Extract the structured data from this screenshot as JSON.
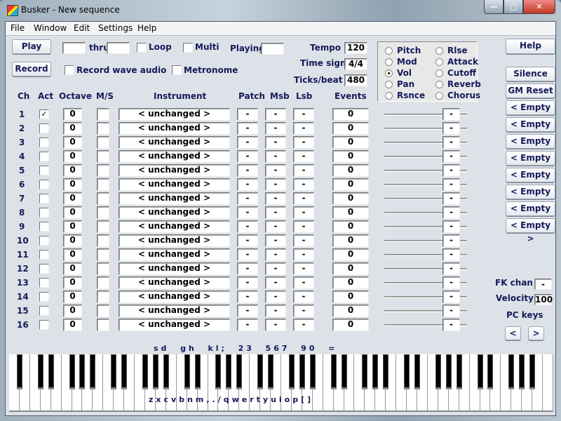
{
  "window": {
    "title": "Busker - New sequence",
    "min": "—",
    "max": "□",
    "close": "✕"
  },
  "menu": [
    "File",
    "Window",
    "Edit",
    "Settings",
    "Help"
  ],
  "transport": {
    "play": "Play",
    "record": "Record",
    "thru": "thru",
    "loop": "Loop",
    "multi": "Multi",
    "playing": "Playing",
    "record_wave": "Record wave audio",
    "metronome": "Metronome",
    "from_value": "",
    "thru_value": "",
    "playing_value": ""
  },
  "settings": {
    "tempo_label": "Tempo",
    "tempo": "120",
    "timesig_label": "Time sign",
    "timesig": "4/4",
    "ticks_label": "Ticks/beat",
    "ticks": "480"
  },
  "controllers": {
    "options": [
      "Pitch",
      "Mod",
      "Vol",
      "Pan",
      "Rsnce",
      "Rlse",
      "Attack",
      "Cutoff",
      "Reverb",
      "Chorus"
    ],
    "selected": "Vol"
  },
  "right_buttons": {
    "help": "Help",
    "silence": "Silence",
    "gm_reset": "GM Reset",
    "presets": [
      "< Empty >",
      "< Empty >",
      "< Empty >",
      "< Empty >",
      "< Empty >",
      "< Empty >",
      "< Empty >",
      "< Empty >"
    ]
  },
  "headers": {
    "ch": "Ch",
    "act": "Act",
    "octave": "Octave",
    "ms": "M/S",
    "instrument": "Instrument",
    "patch": "Patch",
    "msb": "Msb",
    "lsb": "Lsb",
    "events": "Events"
  },
  "channels": [
    {
      "ch": "1",
      "act": true,
      "octave": "0",
      "ms": "",
      "instrument": "< unchanged >",
      "patch": "-",
      "msb": "-",
      "lsb": "-",
      "events": "0",
      "ctrl": "-"
    },
    {
      "ch": "2",
      "act": false,
      "octave": "0",
      "ms": "",
      "instrument": "< unchanged >",
      "patch": "-",
      "msb": "-",
      "lsb": "-",
      "events": "0",
      "ctrl": "-"
    },
    {
      "ch": "3",
      "act": false,
      "octave": "0",
      "ms": "",
      "instrument": "< unchanged >",
      "patch": "-",
      "msb": "-",
      "lsb": "-",
      "events": "0",
      "ctrl": "-"
    },
    {
      "ch": "4",
      "act": false,
      "octave": "0",
      "ms": "",
      "instrument": "< unchanged >",
      "patch": "-",
      "msb": "-",
      "lsb": "-",
      "events": "0",
      "ctrl": "-"
    },
    {
      "ch": "5",
      "act": false,
      "octave": "0",
      "ms": "",
      "instrument": "< unchanged >",
      "patch": "-",
      "msb": "-",
      "lsb": "-",
      "events": "0",
      "ctrl": "-"
    },
    {
      "ch": "6",
      "act": false,
      "octave": "0",
      "ms": "",
      "instrument": "< unchanged >",
      "patch": "-",
      "msb": "-",
      "lsb": "-",
      "events": "0",
      "ctrl": "-"
    },
    {
      "ch": "7",
      "act": false,
      "octave": "0",
      "ms": "",
      "instrument": "< unchanged >",
      "patch": "-",
      "msb": "-",
      "lsb": "-",
      "events": "0",
      "ctrl": "-"
    },
    {
      "ch": "8",
      "act": false,
      "octave": "0",
      "ms": "",
      "instrument": "< unchanged >",
      "patch": "-",
      "msb": "-",
      "lsb": "-",
      "events": "0",
      "ctrl": "-"
    },
    {
      "ch": "9",
      "act": false,
      "octave": "0",
      "ms": "",
      "instrument": "< unchanged >",
      "patch": "-",
      "msb": "-",
      "lsb": "-",
      "events": "0",
      "ctrl": "-"
    },
    {
      "ch": "10",
      "act": false,
      "octave": "0",
      "ms": "",
      "instrument": "< unchanged >",
      "patch": "-",
      "msb": "-",
      "lsb": "-",
      "events": "0",
      "ctrl": "-"
    },
    {
      "ch": "11",
      "act": false,
      "octave": "0",
      "ms": "",
      "instrument": "< unchanged >",
      "patch": "-",
      "msb": "-",
      "lsb": "-",
      "events": "0",
      "ctrl": "-"
    },
    {
      "ch": "12",
      "act": false,
      "octave": "0",
      "ms": "",
      "instrument": "< unchanged >",
      "patch": "-",
      "msb": "-",
      "lsb": "-",
      "events": "0",
      "ctrl": "-"
    },
    {
      "ch": "13",
      "act": false,
      "octave": "0",
      "ms": "",
      "instrument": "< unchanged >",
      "patch": "-",
      "msb": "-",
      "lsb": "-",
      "events": "0",
      "ctrl": "-"
    },
    {
      "ch": "14",
      "act": false,
      "octave": "0",
      "ms": "",
      "instrument": "< unchanged >",
      "patch": "-",
      "msb": "-",
      "lsb": "-",
      "events": "0",
      "ctrl": "-"
    },
    {
      "ch": "15",
      "act": false,
      "octave": "0",
      "ms": "",
      "instrument": "< unchanged >",
      "patch": "-",
      "msb": "-",
      "lsb": "-",
      "events": "0",
      "ctrl": "-"
    },
    {
      "ch": "16",
      "act": false,
      "octave": "0",
      "ms": "",
      "instrument": "< unchanged >",
      "patch": "-",
      "msb": "-",
      "lsb": "-",
      "events": "0",
      "ctrl": "-"
    }
  ],
  "fk": {
    "fk_chan_label": "FK chan",
    "fk_chan": "-",
    "velocity_label": "Velocity",
    "velocity": "100",
    "pc_keys": "PC keys",
    "prev": "<",
    "next": ">"
  },
  "keyboard": {
    "upper_keys": "sd  gh  kl;  23  567  90  =",
    "lower_keys": "zxcvbnm,./qwertyuiop[]",
    "white_keys": 52,
    "first_note": "A"
  }
}
